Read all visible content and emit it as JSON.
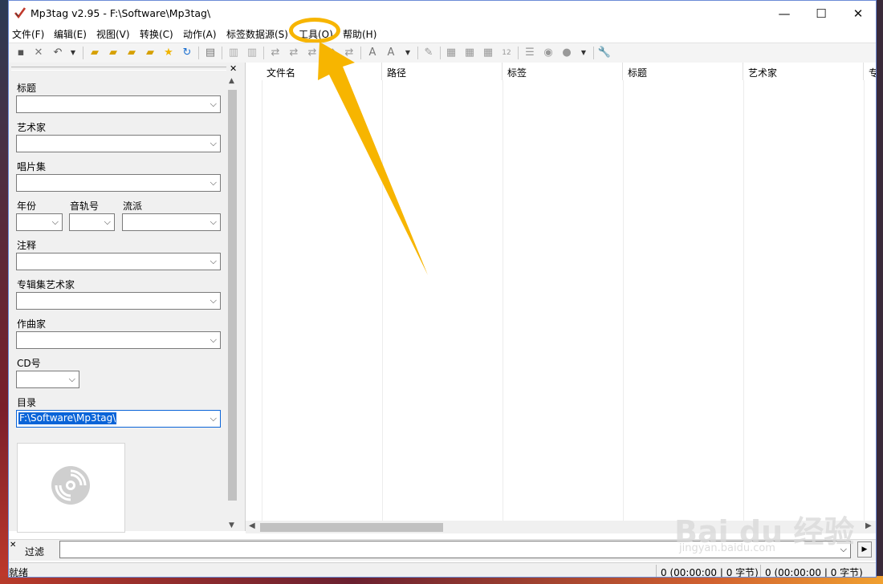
{
  "window": {
    "title": "Mp3tag v2.95  -  F:\\Software\\Mp3tag\\",
    "minimize": "—",
    "maximize": "☐",
    "close": "✕"
  },
  "menu": [
    {
      "label": "文件(F)"
    },
    {
      "label": "编辑(E)"
    },
    {
      "label": "视图(V)"
    },
    {
      "label": "转换(C)"
    },
    {
      "label": "动作(A)"
    },
    {
      "label": "标签数据源(S)"
    },
    {
      "label": "工具(O)"
    },
    {
      "label": "帮助(H)"
    }
  ],
  "toolbar_icons": [
    "save-icon",
    "remove-tag-icon",
    "undo-icon",
    "undo-dropdown-icon",
    "change-dir-icon",
    "add-dir-icon",
    "export-icon",
    "open-icon",
    "favorite-icon",
    "refresh-icon",
    "tag-panel-icon",
    "print-icon",
    "print-preview-icon",
    "tag-filename-icon",
    "filename-tag-icon",
    "text-tag-icon",
    "tag-tag-icon",
    "autonumber-icon",
    "case-convert-icon",
    "case-dropdown-icon",
    "edit-icon",
    "extended-tags-icon",
    "playlist-icon",
    "export2-icon",
    "numbering-icon",
    "tag-sources-icon",
    "web-icon",
    "options-dropdown-icon",
    "options-arrow-icon",
    "wrench-icon"
  ],
  "tag_panel": {
    "title_label": "标题",
    "artist_label": "艺术家",
    "album_label": "唱片集",
    "year_label": "年份",
    "track_label": "音轨号",
    "genre_label": "流派",
    "comment_label": "注释",
    "album_artist_label": "专辑集艺术家",
    "composer_label": "作曲家",
    "disc_label": "CD号",
    "directory_label": "目录",
    "directory_value": "F:\\Software\\Mp3tag\\"
  },
  "file_list": {
    "columns": [
      "文件名",
      "路径",
      "标签",
      "标题",
      "艺术家",
      "专"
    ]
  },
  "filter": {
    "label": "过滤",
    "value": ""
  },
  "status": {
    "ready": "就绪",
    "selected": "0 (00:00:00 | 0 字节)",
    "total": "0 (00:00:00 | 0 字节)"
  },
  "watermark": {
    "brand": "Bai du 经验",
    "url": "jingyan.baidu.com"
  },
  "colors": {
    "accent_ring": "#f7b500",
    "selection": "#0a64d8"
  }
}
